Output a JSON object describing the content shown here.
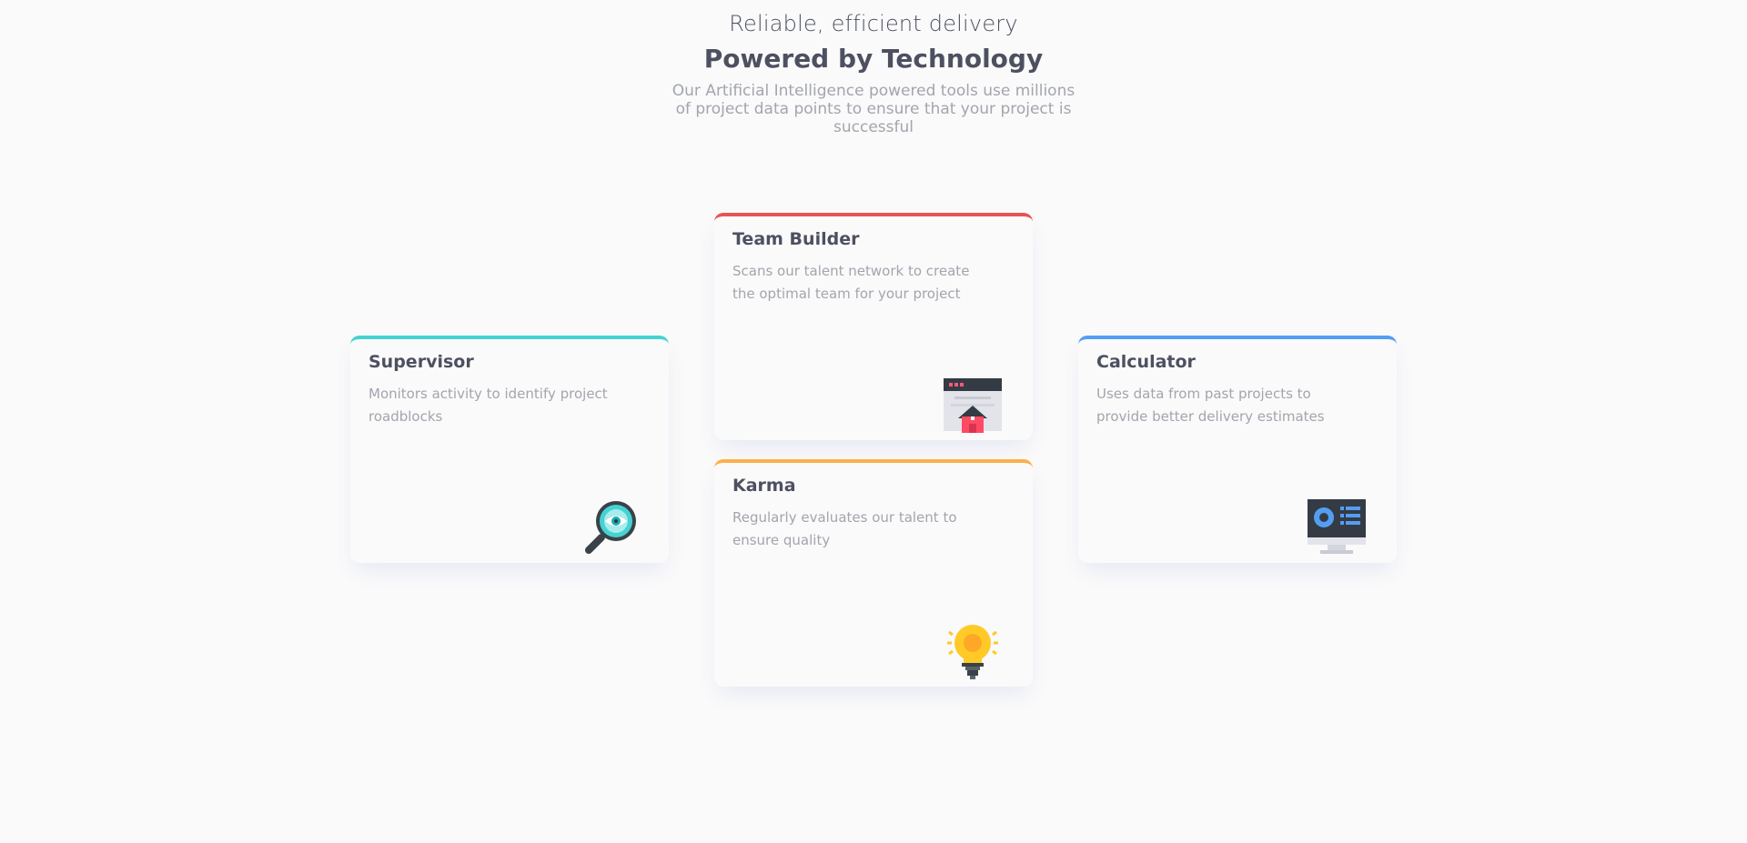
{
  "intro": {
    "subtitle": "Reliable, efficient delivery",
    "title": "Powered by Technology",
    "description": "Our Artificial Intelligence powered tools use millions of project data points to ensure that your project is successful"
  },
  "cards": [
    {
      "title": "Supervisor",
      "description": "Monitors activity to identify project roadblocks",
      "accent": "#44d3d2",
      "icon": "magnifier-eye-icon"
    },
    {
      "title": "Team Builder",
      "description": "Scans our talent network to create the optimal team for your project",
      "accent": "#ea5353",
      "icon": "browser-house-icon"
    },
    {
      "title": "Karma",
      "description": "Regularly evaluates our talent to ensure quality",
      "accent": "#fcaf4a",
      "icon": "lightbulb-icon"
    },
    {
      "title": "Calculator",
      "description": "Uses data from past projects to provide better delivery estimates",
      "accent": "#549ef2",
      "icon": "monitor-chart-icon"
    }
  ],
  "colors": {
    "background": "#fafafa",
    "heading": "#4d5060",
    "muted": "#a3a5ae"
  }
}
